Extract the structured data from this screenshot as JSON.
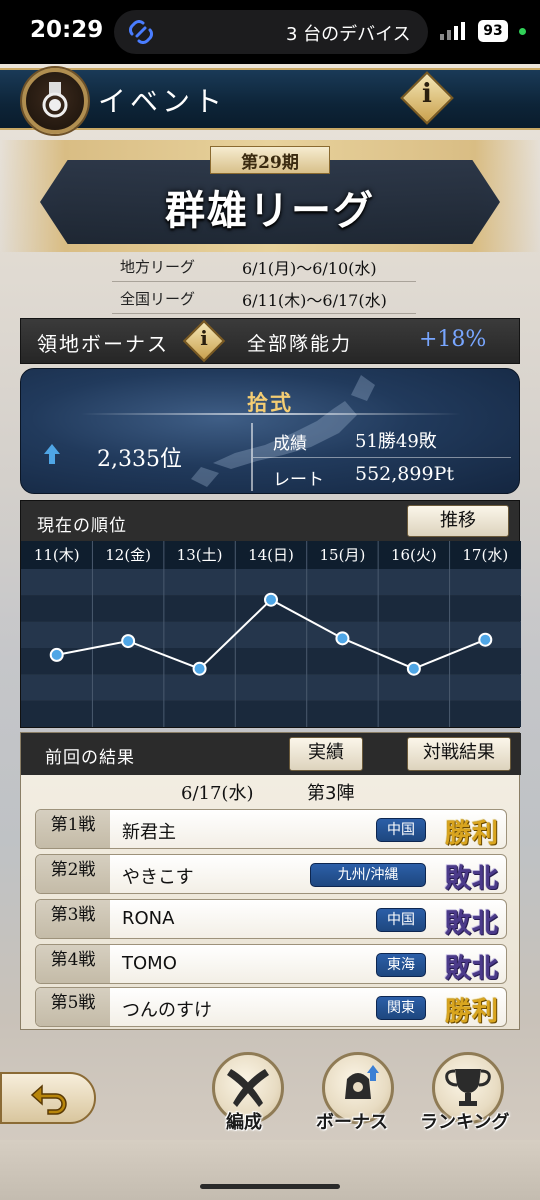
{
  "status_bar": {
    "time": "20:29",
    "devices_label": "3 台のデバイス",
    "battery": "93"
  },
  "header": {
    "title": "イベント",
    "info_label": "i"
  },
  "season": {
    "number": "第29期",
    "title": "群雄リーグ"
  },
  "schedule": [
    {
      "label": "地方リーグ",
      "dates": "6/1(月)〜6/10(水)"
    },
    {
      "label": "全国リーグ",
      "dates": "6/11(木)〜6/17(水)"
    }
  ],
  "bonus": {
    "label": "領地ボーナス",
    "info_label": "i",
    "description": "全部隊能力",
    "value": "+18%"
  },
  "rank": {
    "tier": "拾式",
    "position": "2,335位",
    "record_label": "成績",
    "record_value": "51勝49敗",
    "rate_label": "レート",
    "rate_value": "552,899Pt"
  },
  "ranking_chart": {
    "title": "現在の順位",
    "trend_button": "推移",
    "accent_color": "#4fa6e6"
  },
  "chart_data": {
    "type": "line",
    "title": "現在の順位",
    "categories": [
      "11(木)",
      "12(金)",
      "13(土)",
      "14(日)",
      "15(月)",
      "16(火)",
      "17(水)"
    ],
    "values": [
      0.45,
      0.55,
      0.35,
      0.85,
      0.57,
      0.35,
      0.56
    ],
    "xlabel": "",
    "ylabel": "",
    "grid": true
  },
  "results": {
    "title": "前回の結果",
    "achievements_button": "実績",
    "battle_results_button": "対戦結果",
    "date": "6/17(水)",
    "round": "第3陣",
    "matches": [
      {
        "num": "第1戦",
        "name": "新君主",
        "region": "中国",
        "result": "勝利",
        "win": true
      },
      {
        "num": "第2戦",
        "name": "やきこす",
        "region": "九州/沖縄",
        "result": "敗北",
        "win": false
      },
      {
        "num": "第3戦",
        "name": "RONA",
        "region": "中国",
        "result": "敗北",
        "win": false
      },
      {
        "num": "第4戦",
        "name": "TOMO",
        "region": "東海",
        "result": "敗北",
        "win": false
      },
      {
        "num": "第5戦",
        "name": "つんのすけ",
        "region": "関東",
        "result": "勝利",
        "win": true
      }
    ]
  },
  "bottom_nav": {
    "items": [
      {
        "label": "編成",
        "icon": "formation-icon"
      },
      {
        "label": "ボーナス",
        "icon": "bonus-icon"
      },
      {
        "label": "ランキング",
        "icon": "trophy-icon"
      }
    ]
  }
}
